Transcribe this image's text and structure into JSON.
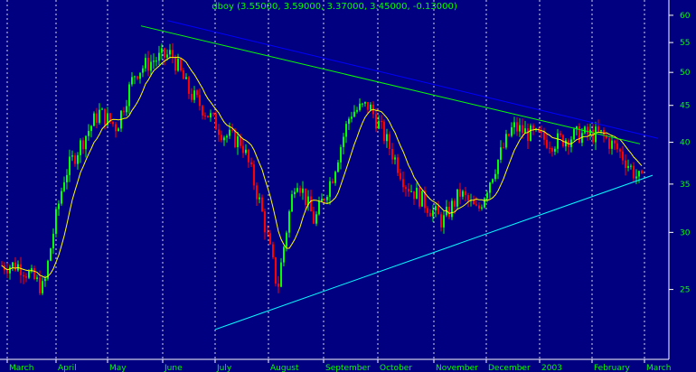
{
  "header": {
    "text": "dboy (3.55000, 3.59000, 3.37000, 3.45000, -0.13000)"
  },
  "chart_data": {
    "type": "candlestick",
    "ticker": "dboy",
    "scale": "log",
    "ylim": [
      20,
      63
    ],
    "y_ticks": [
      25,
      30,
      35,
      40,
      45,
      50,
      55,
      60
    ],
    "month_labels": [
      "March",
      "April",
      "May",
      "June",
      "July",
      "August",
      "September",
      "October",
      "November",
      "December",
      "2003",
      "February",
      "March"
    ],
    "grid": "dotted vertical at month starts",
    "ohlc_last": {
      "open": 3.55,
      "high": 3.59,
      "low": 3.37,
      "close": 3.45,
      "change": -0.13
    },
    "price_path": [
      [
        "March",
        27
      ],
      [
        "March",
        25
      ],
      [
        "April",
        36
      ],
      [
        "April",
        40
      ],
      [
        "April",
        44
      ],
      [
        "May",
        42
      ],
      [
        "May",
        50
      ],
      [
        "May",
        52
      ],
      [
        "June",
        53
      ],
      [
        "June",
        47
      ],
      [
        "June",
        44
      ],
      [
        "July",
        41
      ],
      [
        "July",
        40
      ],
      [
        "July",
        33
      ],
      [
        "August",
        25
      ],
      [
        "August",
        36
      ],
      [
        "August",
        31
      ],
      [
        "September",
        36
      ],
      [
        "September",
        44
      ],
      [
        "September",
        45
      ],
      [
        "October",
        40
      ],
      [
        "October",
        35
      ],
      [
        "October",
        33
      ],
      [
        "November",
        31
      ],
      [
        "November",
        34
      ],
      [
        "November",
        32
      ],
      [
        "December",
        37
      ],
      [
        "December",
        42
      ],
      [
        "December",
        41
      ],
      [
        "2003",
        40
      ],
      [
        "2003",
        41
      ],
      [
        "February",
        41
      ],
      [
        "February",
        39
      ],
      [
        "February",
        36
      ],
      [
        "March",
        34.5
      ]
    ],
    "moving_average": {
      "color": "#ffff00"
    },
    "trendlines": [
      {
        "name": "upper-blue-resistance",
        "color": "#0000ff",
        "from": [
          "June",
          59
        ],
        "to": [
          "March",
          40.5
        ]
      },
      {
        "name": "green-resistance",
        "color": "#00ff00",
        "from": [
          "May",
          58
        ],
        "to": [
          "February",
          39.8
        ]
      },
      {
        "name": "cyan-support",
        "color": "#00ffff",
        "from": [
          "July",
          22
        ],
        "to": [
          "March",
          36
        ]
      }
    ],
    "colors": {
      "up": "#00ff00",
      "down": "#ff0000",
      "axis_text": "#00ff00",
      "grid": "#ffffff",
      "background": "#000080"
    }
  }
}
